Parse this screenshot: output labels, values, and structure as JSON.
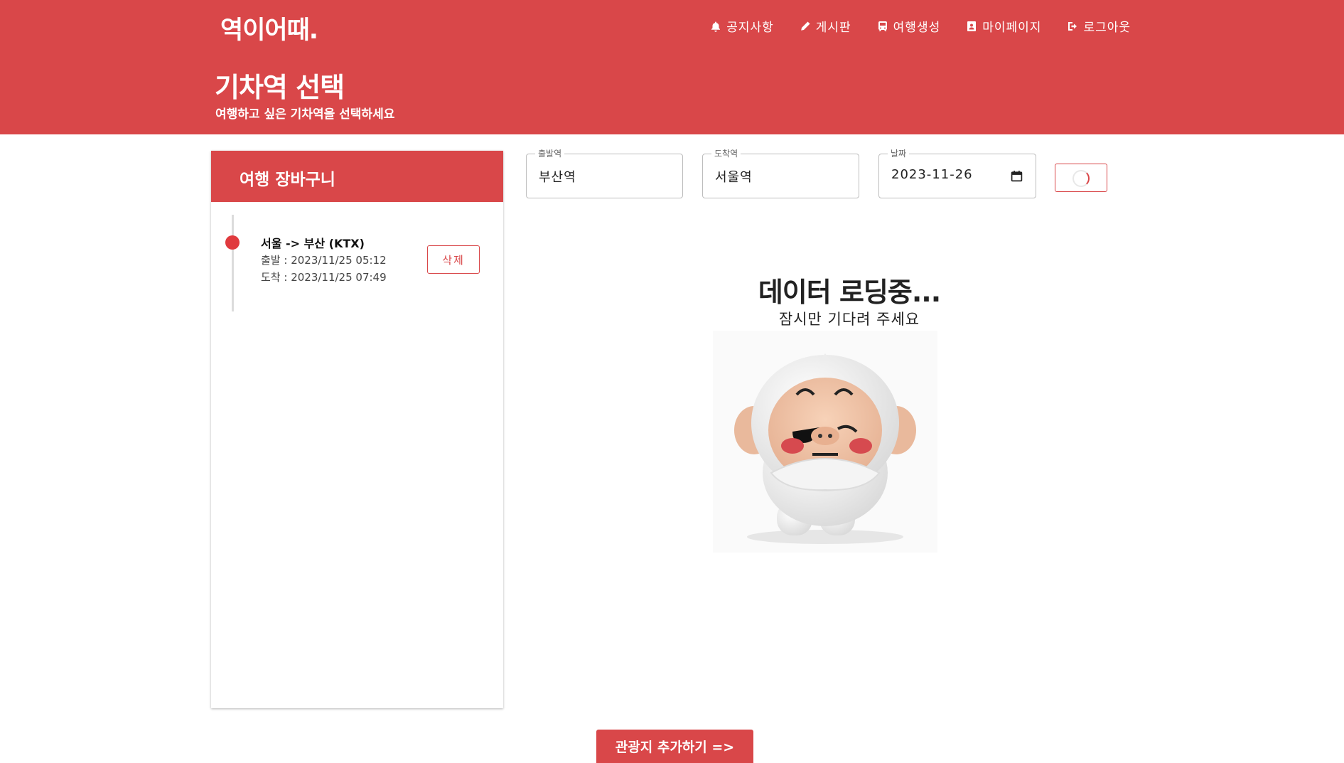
{
  "header": {
    "logo": "역이어때.",
    "page_title": "기차역 선택",
    "page_subtitle": "여행하고 싶은 기차역을 선택하세요"
  },
  "nav": [
    {
      "label": "공지사항",
      "icon": "bell-icon"
    },
    {
      "label": "게시판",
      "icon": "pencil-icon"
    },
    {
      "label": "여행생성",
      "icon": "train-icon"
    },
    {
      "label": "마이페이지",
      "icon": "profile-icon"
    },
    {
      "label": "로그아웃",
      "icon": "logout-icon"
    }
  ],
  "cart": {
    "title": "여행 장바구니",
    "items": [
      {
        "title": "서울 -> 부산 (KTX)",
        "departure": "출발 : 2023/11/25 05:12",
        "arrival": "도착 : 2023/11/25 07:49",
        "delete_label": "삭제"
      }
    ]
  },
  "search": {
    "departure_label": "출발역",
    "departure_value": "부산역",
    "arrival_label": "도착역",
    "arrival_value": "서울역",
    "date_label": "날짜",
    "date_value": "2023-11-26"
  },
  "loading": {
    "title": "데이터 로딩중...",
    "subtitle": "잠시만 기다려 주세요"
  },
  "next_button": "관광지 추가하기 =>",
  "colors": {
    "brand": "#d94749",
    "timeline_dot": "#e03a3e"
  }
}
